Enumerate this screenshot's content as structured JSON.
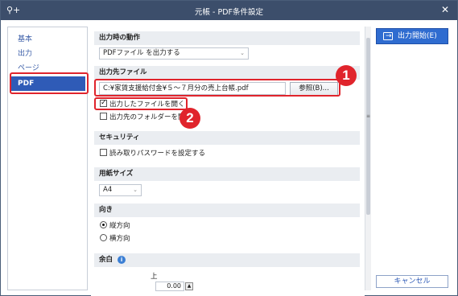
{
  "window": {
    "title": "元帳 - PDF条件設定",
    "pin_icon": "pin-add-icon",
    "close_icon": "close-icon"
  },
  "sidebar": {
    "items": [
      {
        "label": "基本"
      },
      {
        "label": "出力"
      },
      {
        "label": "ページ"
      },
      {
        "label": "PDF",
        "active": true
      }
    ]
  },
  "sections": {
    "behavior": {
      "title": "出力時の動作",
      "select_value": "PDFファイル を出力する"
    },
    "destination": {
      "title": "出力先ファイル",
      "path_value": "C:¥家賃支援給付金¥５～７月分の売上台帳.pdf",
      "browse_label": "参照(B)...",
      "open_file_label": "出力したファイルを開く",
      "open_file_checked": true,
      "open_folder_label": "出力先のフォルダーを開く",
      "open_folder_checked": false
    },
    "security": {
      "title": "セキュリティ",
      "password_label": "読み取りパスワードを設定する",
      "password_checked": false
    },
    "paper": {
      "title": "用紙サイズ",
      "select_value": "A4"
    },
    "orientation": {
      "title": "向き",
      "portrait": "縦方向",
      "landscape": "横方向",
      "selected": "portrait"
    },
    "margin": {
      "title": "余白",
      "top_label": "上",
      "top_value": "0.00"
    }
  },
  "actions": {
    "primary_label": "出力開始(E)",
    "cancel_label": "キャンセル"
  },
  "annotations": {
    "badge1": "1",
    "badge2": "2"
  },
  "colors": {
    "titlebar": "#3c4e6b",
    "accent": "#2f5bb7",
    "highlight": "#e0242c",
    "primary_button": "#2f6cd0"
  }
}
